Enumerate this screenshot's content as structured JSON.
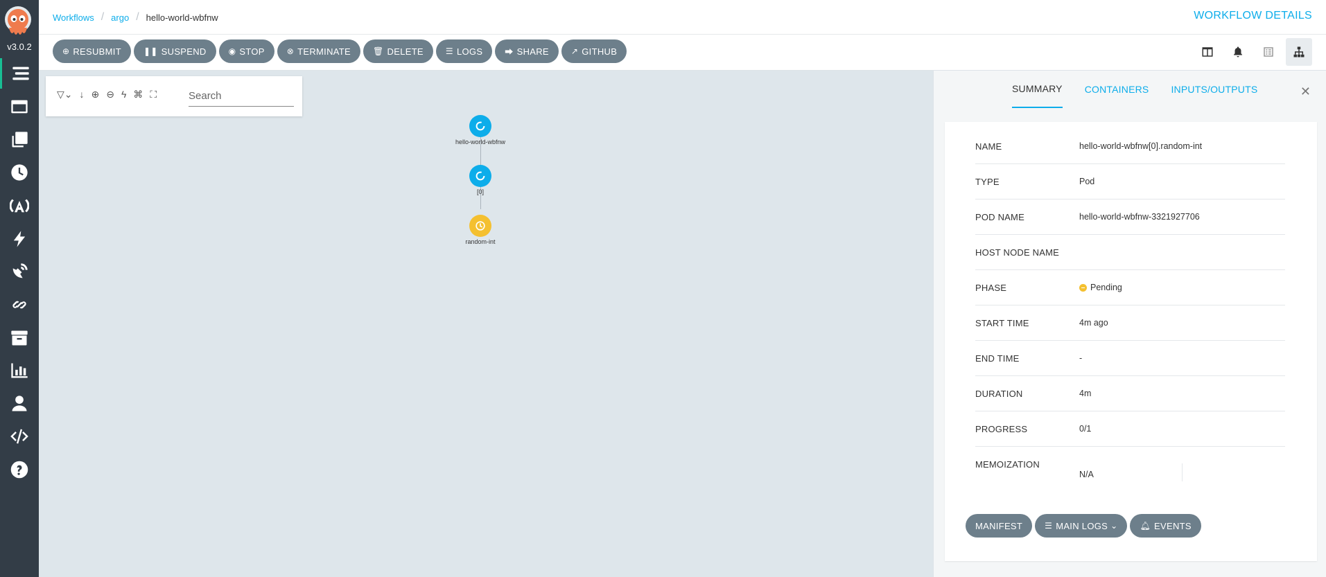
{
  "app": {
    "version": "v3.0.2"
  },
  "header": {
    "breadcrumb": [
      "Workflows",
      "argo",
      "hello-world-wbfnw"
    ],
    "page_title": "WORKFLOW DETAILS"
  },
  "toolbar": {
    "actions": [
      {
        "label": "RESUBMIT",
        "icon": "plus-circle-icon"
      },
      {
        "label": "SUSPEND",
        "icon": "pause-icon"
      },
      {
        "label": "STOP",
        "icon": "stop-circle-icon"
      },
      {
        "label": "TERMINATE",
        "icon": "times-circle-icon"
      },
      {
        "label": "DELETE",
        "icon": "trash-icon"
      },
      {
        "label": "LOGS",
        "icon": "bars-icon"
      },
      {
        "label": "SHARE",
        "icon": "share-icon"
      },
      {
        "label": "GITHUB",
        "icon": "external-link-icon"
      }
    ]
  },
  "graph": {
    "search_placeholder": "Search",
    "nodes": [
      {
        "label": "hello-world-wbfnw",
        "phase": "Running"
      },
      {
        "label": "[0]",
        "phase": "Running"
      },
      {
        "label": "random-int",
        "phase": "Pending"
      }
    ]
  },
  "panel": {
    "tabs": [
      "SUMMARY",
      "CONTAINERS",
      "INPUTS/OUTPUTS"
    ],
    "rows": [
      {
        "key": "NAME",
        "value": "hello-world-wbfnw[0].random-int"
      },
      {
        "key": "TYPE",
        "value": "Pod"
      },
      {
        "key": "POD NAME",
        "value": "hello-world-wbfnw-3321927706"
      },
      {
        "key": "HOST NODE NAME",
        "value": ""
      },
      {
        "key": "PHASE",
        "value": "Pending"
      },
      {
        "key": "START TIME",
        "value": "4m ago"
      },
      {
        "key": "END TIME",
        "value": "-"
      },
      {
        "key": "DURATION",
        "value": "4m"
      },
      {
        "key": "PROGRESS",
        "value": "0/1"
      },
      {
        "key": "MEMOIZATION",
        "value": "N/A"
      }
    ],
    "buttons": {
      "manifest": "MANIFEST",
      "main_logs": "MAIN LOGS",
      "events": "EVENTS"
    }
  },
  "colors": {
    "sidebar": "#333d47",
    "accent": "#0dadea",
    "button": "#6d7f8b",
    "running": "#0dadea",
    "pending": "#f4c030",
    "active_indicator": "#18be94"
  }
}
